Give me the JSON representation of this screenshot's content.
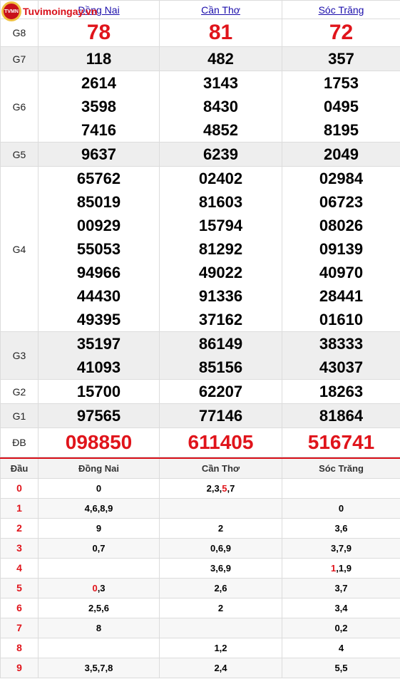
{
  "logo": {
    "text": "Tuvimoingay.vn",
    "badge": "TVMN"
  },
  "provinces": [
    "Đồng Nai",
    "Cần Thơ",
    "Sóc Trăng"
  ],
  "prizes": [
    {
      "label": "G8",
      "rows": [
        [
          "78",
          "81",
          "72"
        ]
      ]
    },
    {
      "label": "G7",
      "rows": [
        [
          "118",
          "482",
          "357"
        ]
      ]
    },
    {
      "label": "G6",
      "rows": [
        [
          "2614",
          "3143",
          "1753"
        ],
        [
          "3598",
          "8430",
          "0495"
        ],
        [
          "7416",
          "4852",
          "8195"
        ]
      ]
    },
    {
      "label": "G5",
      "rows": [
        [
          "9637",
          "6239",
          "2049"
        ]
      ]
    },
    {
      "label": "G4",
      "rows": [
        [
          "65762",
          "02402",
          "02984"
        ],
        [
          "85019",
          "81603",
          "06723"
        ],
        [
          "00929",
          "15794",
          "08026"
        ],
        [
          "55053",
          "81292",
          "09139"
        ],
        [
          "94966",
          "49022",
          "40970"
        ],
        [
          "44430",
          "91336",
          "28441"
        ],
        [
          "49395",
          "37162",
          "01610"
        ]
      ]
    },
    {
      "label": "G3",
      "rows": [
        [
          "35197",
          "86149",
          "38333"
        ],
        [
          "41093",
          "85156",
          "43037"
        ]
      ]
    },
    {
      "label": "G2",
      "rows": [
        [
          "15700",
          "62207",
          "18263"
        ]
      ]
    },
    {
      "label": "G1",
      "rows": [
        [
          "97565",
          "77146",
          "81864"
        ]
      ]
    },
    {
      "label": "ĐB",
      "rows": [
        [
          "098850",
          "611405",
          "516741"
        ]
      ]
    }
  ],
  "loto": {
    "header_label": "Đầu",
    "rows": [
      {
        "head": "0",
        "cells": [
          [
            {
              "t": "0",
              "red": false
            }
          ],
          [
            {
              "t": "2,3,",
              "red": false
            },
            {
              "t": "5",
              "red": true
            },
            {
              "t": ",7",
              "red": false
            }
          ],
          []
        ]
      },
      {
        "head": "1",
        "cells": [
          [
            {
              "t": "4,6,8,9",
              "red": false
            }
          ],
          [],
          [
            {
              "t": "0",
              "red": false
            }
          ]
        ]
      },
      {
        "head": "2",
        "cells": [
          [
            {
              "t": "9",
              "red": false
            }
          ],
          [
            {
              "t": "2",
              "red": false
            }
          ],
          [
            {
              "t": "3,6",
              "red": false
            }
          ]
        ]
      },
      {
        "head": "3",
        "cells": [
          [
            {
              "t": "0,7",
              "red": false
            }
          ],
          [
            {
              "t": "0,6,9",
              "red": false
            }
          ],
          [
            {
              "t": "3,7,9",
              "red": false
            }
          ]
        ]
      },
      {
        "head": "4",
        "cells": [
          [],
          [
            {
              "t": "3,6,9",
              "red": false
            }
          ],
          [
            {
              "t": "1",
              "red": true
            },
            {
              "t": ",1,9",
              "red": false
            }
          ]
        ]
      },
      {
        "head": "5",
        "cells": [
          [
            {
              "t": "0",
              "red": true
            },
            {
              "t": ",3",
              "red": false
            }
          ],
          [
            {
              "t": "2,6",
              "red": false
            }
          ],
          [
            {
              "t": "3,7",
              "red": false
            }
          ]
        ]
      },
      {
        "head": "6",
        "cells": [
          [
            {
              "t": "2,5,6",
              "red": false
            }
          ],
          [
            {
              "t": "2",
              "red": false
            }
          ],
          [
            {
              "t": "3,4",
              "red": false
            }
          ]
        ]
      },
      {
        "head": "7",
        "cells": [
          [
            {
              "t": "8",
              "red": false
            }
          ],
          [],
          [
            {
              "t": "0,2",
              "red": false
            }
          ]
        ]
      },
      {
        "head": "8",
        "cells": [
          [],
          [
            {
              "t": "1,2",
              "red": false
            }
          ],
          [
            {
              "t": "4",
              "red": false
            }
          ]
        ]
      },
      {
        "head": "9",
        "cells": [
          [
            {
              "t": "3,5,7,8",
              "red": false
            }
          ],
          [
            {
              "t": "2,4",
              "red": false
            }
          ],
          [
            {
              "t": "5,5",
              "red": false
            }
          ]
        ]
      }
    ]
  },
  "colors": {
    "accent_red": "#e0141b",
    "link_blue": "#1a0dab",
    "shade": "#eeeeee"
  }
}
